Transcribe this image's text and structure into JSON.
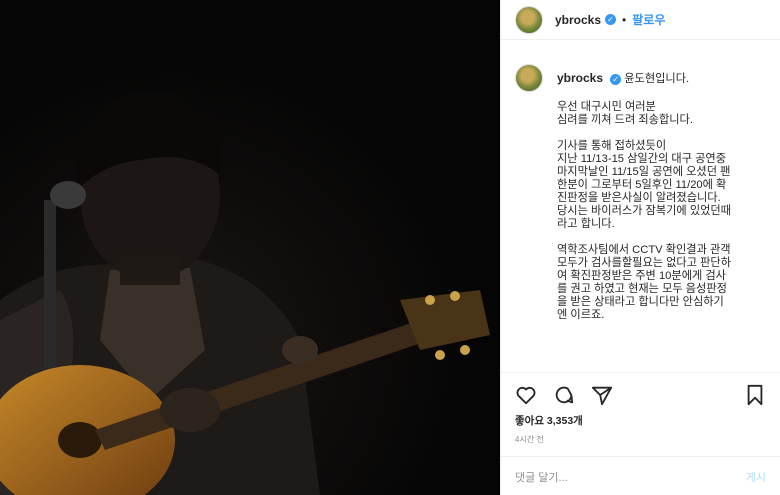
{
  "post": {
    "username": "ybrocks",
    "follow_label": "팔로우",
    "separator": "•",
    "verified_badge_icon": "verified-check-icon",
    "caption_header": "윤도현입니다.",
    "caption_paragraphs": [
      "우선 대구시민 여러분\n심려를 끼쳐 드려 죄송합니다.",
      "기사를 통해 접하셨듯이\n지난 11/13-15 삼일간의 대구 공연중\n마지막날인 11/15일 공연에 오셨던 팬\n한분이 그로부터 5일후인 11/20에 확\n진판정을 받은사실이 알려졌습니다.\n당시는 바이러스가 잠복기에 있었던때\n라고 합니다.",
      "역학조사팀에서 CCTV 확인결과 관객\n모두가 검사를할필요는 없다고 판단하\n여 확진판정받은 주변 10분에게 검사\n를 권고 하였고 현재는 모두 음성판정\n을 받은 상태라고 합니다만 안심하기\n엔 이르죠."
    ],
    "likes_label": "좋아요 3,353개",
    "time_ago": "4시간 전",
    "comment_placeholder": "댓글 달기...",
    "post_button": "게시"
  },
  "icons": [
    "heart-icon",
    "comment-icon",
    "share-icon",
    "bookmark-icon"
  ],
  "colors": {
    "accent": "#3897f0",
    "text": "#262626",
    "muted": "#8e8e8e"
  }
}
